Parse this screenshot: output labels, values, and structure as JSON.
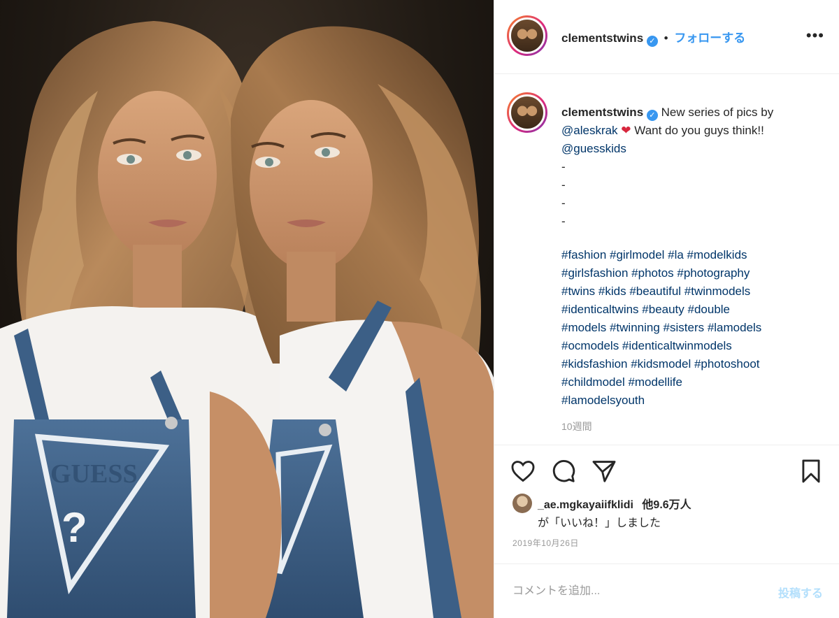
{
  "post": {
    "username": "clementstwins",
    "verified_glyph": "✓",
    "separator": "•",
    "follow_label": "フォローする",
    "more_glyph": "•••"
  },
  "caption": {
    "username": "clementstwins",
    "text_1": "New series of pics by",
    "mention_1": "@aleskrak",
    "emoji": "❤",
    "text_2": "Want do you guys think!!",
    "mention_2": "@guesskids",
    "dashes": [
      "-",
      "-",
      "-",
      "-"
    ],
    "hashtags": [
      "#fashion #girlmodel #la #modelkids",
      "#girlsfashion #photos #photography",
      "#twins #kids #beautiful #twinmodels",
      "#identicaltwins #beauty #double",
      "#models #twinning #sisters #lamodels",
      "#ocmodels #identicaltwinmodels",
      "#kidsfashion #kidsmodel #photoshoot",
      "#childmodel #modellife",
      "#lamodelsyouth"
    ],
    "time_ago": "10週間"
  },
  "actions": {
    "like_icon": "heart-outline",
    "comment_icon": "speech-bubble",
    "share_icon": "paper-plane",
    "save_icon": "bookmark"
  },
  "likes": {
    "liker": "_ae.mgkayaiifklidi",
    "others": "他9.6万人",
    "suffix": "が「いいね！」しました"
  },
  "date": "2019年10月26日",
  "comment": {
    "placeholder": "コメントを追加...",
    "post_label": "投稿する"
  },
  "photo": {
    "shirt_logo_text": "GUESS",
    "logo_mark": "?"
  }
}
